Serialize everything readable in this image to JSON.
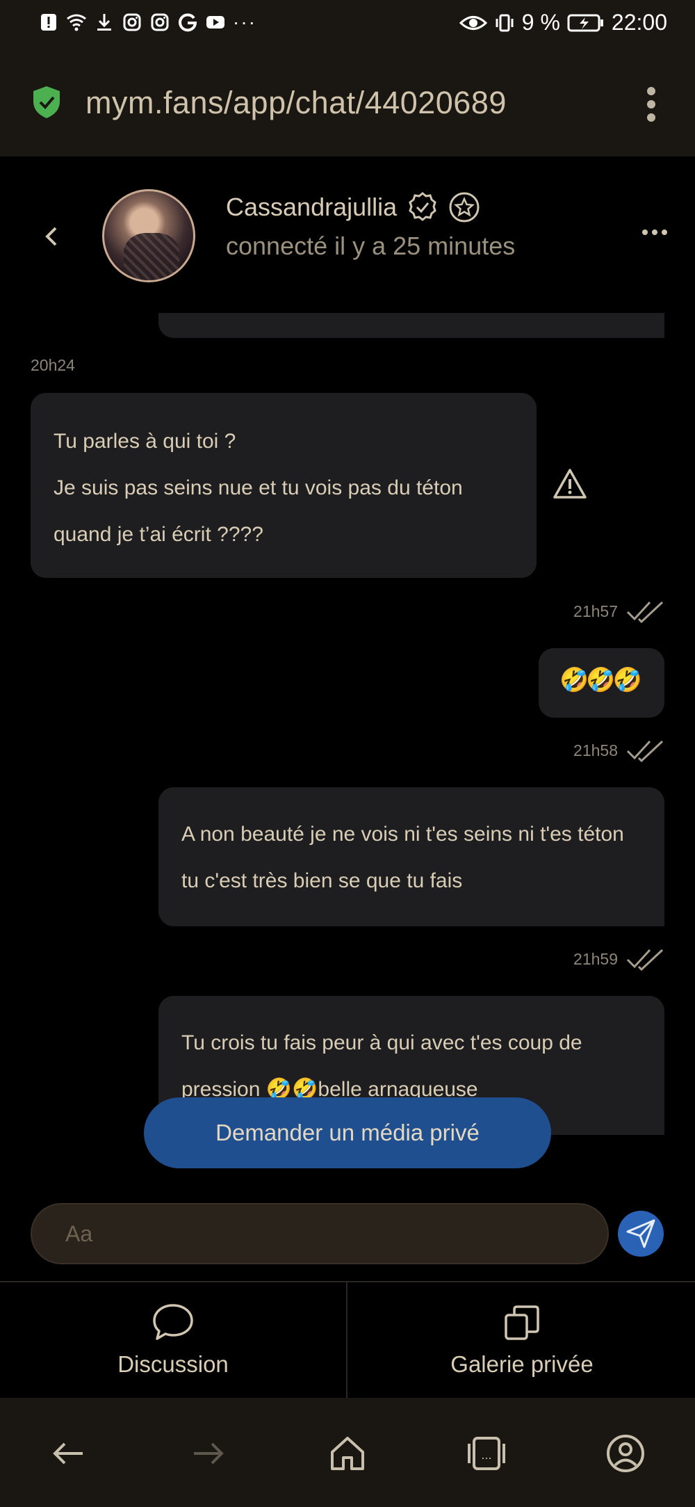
{
  "status_bar": {
    "battery": "9 %",
    "time": "22:00"
  },
  "browser": {
    "url": "mym.fans/app/chat/44020689"
  },
  "chat_header": {
    "name": "Cassandrajullia",
    "presence": "connecté il y a 25 minutes"
  },
  "messages": {
    "first_time": "20h24",
    "incoming_1_line1": "Tu parles à qui toi ?",
    "incoming_1_line2": "Je suis pas seins nue et tu vois pas du téton quand je t’ai écrit ????",
    "ts_2": "21h57",
    "outgoing_emoji": "🤣🤣🤣",
    "ts_3": "21h58",
    "outgoing_2": "A non beauté je ne vois ni t'es seins ni t'es téton tu c'est très bien se que tu fais",
    "ts_4": "21h59",
    "outgoing_3": "Tu crois tu fais peur à qui avec t'es coup de pression 🤣🤣belle arnaqueuse"
  },
  "request_media_label": "Demander un média privé",
  "composer": {
    "placeholder": "Aa"
  },
  "tabs": {
    "discussion": "Discussion",
    "galerie": "Galerie privée"
  },
  "colors": {
    "accent_blue": "#2a63b5",
    "button_blue": "#1f4f8f",
    "shield_green": "#4caf50",
    "bubble_bg": "#1e1e20",
    "text": "#d9cdb5"
  }
}
